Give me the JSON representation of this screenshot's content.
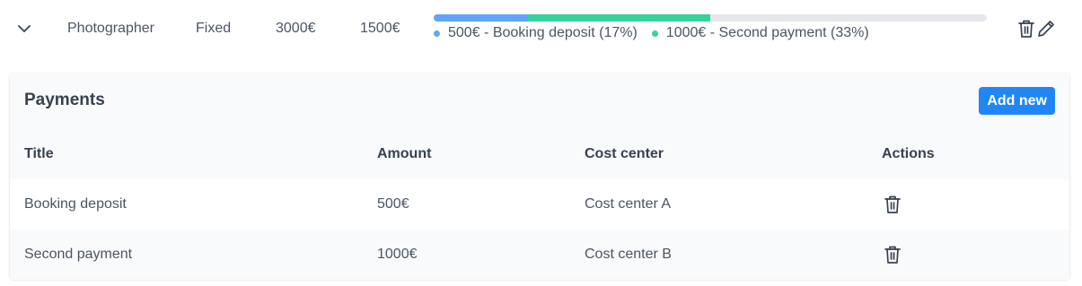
{
  "row": {
    "role": "Photographer",
    "type": "Fixed",
    "total": "3000€",
    "paid": "1500€"
  },
  "progress": {
    "segments": [
      {
        "label": "500€ - Booking deposit (17%)",
        "fraction": 0.17,
        "color": "#60a5fa"
      },
      {
        "label": "1000€ - Second payment (33%)",
        "fraction": 0.33,
        "color": "#34d399"
      }
    ],
    "track_color": "#e5e7eb"
  },
  "row_actions": {
    "delete_icon": "trash-icon",
    "edit_icon": "pencil-icon"
  },
  "payments": {
    "title": "Payments",
    "add_label": "Add new",
    "accent": "#2186f5",
    "columns": [
      "Title",
      "Amount",
      "Cost center",
      "Actions"
    ],
    "rows": [
      {
        "title": "Booking deposit",
        "amount": "500€",
        "cost_center": "Cost center A"
      },
      {
        "title": "Second payment",
        "amount": "1000€",
        "cost_center": "Cost center B"
      }
    ]
  }
}
